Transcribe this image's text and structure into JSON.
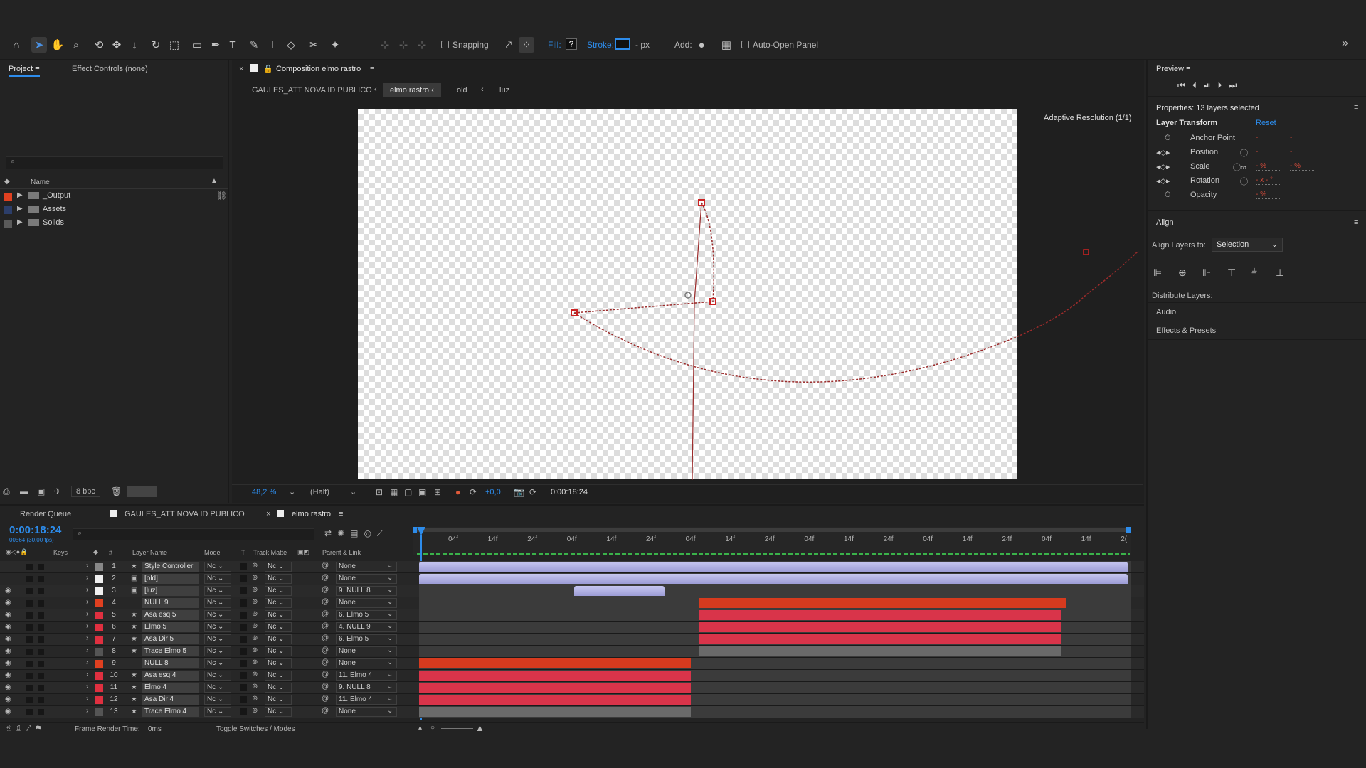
{
  "toolbar": {
    "snapping": "Snapping",
    "fill": "Fill:",
    "fill_value": "?",
    "stroke": "Stroke:",
    "stroke_unit": "- px",
    "add": "Add:",
    "auto_open": "Auto-Open Panel",
    "expand": "»"
  },
  "project": {
    "tab": "Project",
    "effect_controls": "Effect Controls (none)",
    "name_col": "Name",
    "items": [
      "_Output",
      "Assets",
      "Solids"
    ],
    "bpc": "8 bpc"
  },
  "composition": {
    "tab": "Composition elmo rastro",
    "breadcrumbs": [
      "GAULES_ATT NOVA ID PUBLICO",
      "elmo rastro",
      "old",
      "luz"
    ],
    "adaptive": "Adaptive Resolution (1/1)",
    "zoom": "48,2 %",
    "resolution": "(Half)",
    "exposure": "+0,0",
    "timecode": "0:00:18:24"
  },
  "preview": {
    "title": "Preview"
  },
  "properties": {
    "title": "Properties: 13 layers selected",
    "section": "Layer Transform",
    "reset": "Reset",
    "props": [
      {
        "name": "Anchor Point",
        "v1": "-",
        "v2": "-"
      },
      {
        "name": "Position",
        "v1": "-",
        "v2": "-"
      },
      {
        "name": "Scale",
        "v1": "- %",
        "v2": "- %"
      },
      {
        "name": "Rotation",
        "v1": "- x - °",
        "v2": ""
      },
      {
        "name": "Opacity",
        "v1": "- %",
        "v2": ""
      }
    ]
  },
  "align": {
    "title": "Align",
    "align_to": "Align Layers to:",
    "selection": "Selection",
    "distribute": "Distribute Layers:",
    "audio": "Audio",
    "effects": "Effects & Presets"
  },
  "timeline": {
    "tabs": [
      "Render Queue",
      "GAULES_ATT NOVA ID PUBLICO",
      "elmo rastro"
    ],
    "timecode": "0:00:18:24",
    "fps": "00564 (30.00 fps)",
    "headers": {
      "keys": "Keys",
      "num": "#",
      "layer": "Layer Name",
      "mode": "Mode",
      "t": "T",
      "matte": "Track Matte",
      "parent": "Parent & Link"
    },
    "ruler": [
      "04f",
      "14f",
      "24f",
      "04f",
      "14f",
      "24f",
      "04f",
      "14f",
      "24f",
      "04f",
      "14f",
      "24f",
      "04f",
      "14f",
      "24f",
      "04f",
      "14f",
      "2("
    ],
    "layers": [
      {
        "num": "1",
        "name": "Style Controller",
        "mode": "Nc",
        "matte": "Nc",
        "parent": "None",
        "label": "#888888",
        "icon": "★"
      },
      {
        "num": "2",
        "name": "[old]",
        "mode": "Nc",
        "matte": "Nc",
        "parent": "None",
        "label": "#f0f0f0",
        "icon": "▣"
      },
      {
        "num": "3",
        "name": "[luz]",
        "mode": "Nc",
        "matte": "Nc",
        "parent": "9. NULL 8",
        "label": "#f0f0f0",
        "icon": "▣"
      },
      {
        "num": "4",
        "name": "NULL 9",
        "mode": "Nc",
        "matte": "Nc",
        "parent": "None",
        "label": "#e04020",
        "icon": ""
      },
      {
        "num": "5",
        "name": "Asa esq 5",
        "mode": "Nc",
        "matte": "Nc",
        "parent": "6. Elmo 5",
        "label": "#e03040",
        "icon": "★"
      },
      {
        "num": "6",
        "name": "Elmo 5",
        "mode": "Nc",
        "matte": "Nc",
        "parent": "4. NULL 9",
        "label": "#e03040",
        "icon": "★"
      },
      {
        "num": "7",
        "name": "Asa Dir 5",
        "mode": "Nc",
        "matte": "Nc",
        "parent": "6. Elmo 5",
        "label": "#e03040",
        "icon": "★"
      },
      {
        "num": "8",
        "name": "Trace Elmo 5",
        "mode": "Nc",
        "matte": "Nc",
        "parent": "None",
        "label": "#555555",
        "icon": "★"
      },
      {
        "num": "9",
        "name": "NULL 8",
        "mode": "Nc",
        "matte": "Nc",
        "parent": "None",
        "label": "#e04020",
        "icon": ""
      },
      {
        "num": "10",
        "name": "Asa esq 4",
        "mode": "Nc",
        "matte": "Nc",
        "parent": "11. Elmo 4",
        "label": "#e03040",
        "icon": "★"
      },
      {
        "num": "11",
        "name": "Elmo 4",
        "mode": "Nc",
        "matte": "Nc",
        "parent": "9. NULL 8",
        "label": "#e03040",
        "icon": "★"
      },
      {
        "num": "12",
        "name": "Asa Dir 4",
        "mode": "Nc",
        "matte": "Nc",
        "parent": "11. Elmo 4",
        "label": "#e03040",
        "icon": "★"
      },
      {
        "num": "13",
        "name": "Trace Elmo 4",
        "mode": "Nc",
        "matte": "Nc",
        "parent": "None",
        "label": "#555555",
        "icon": "★"
      }
    ],
    "frame_render": "Frame Render Time:",
    "frame_render_val": "0ms",
    "toggle": "Toggle Switches / Modes"
  },
  "colors": {
    "accent": "#2d8ceb",
    "null_bar": "#d63a1e",
    "shape_bar": "#d9344a",
    "footage_bar": "#a9a9e0"
  }
}
